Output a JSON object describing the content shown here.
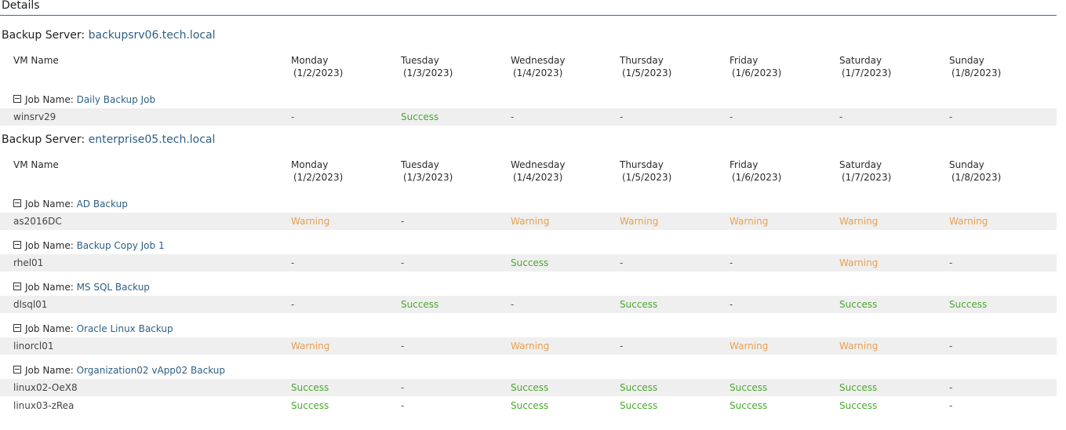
{
  "section_title": "Details",
  "server_label": "Backup Server: ",
  "job_label": "Job Name: ",
  "vm_name_header": "VM Name",
  "days": [
    {
      "day": "Monday",
      "date": "(1/2/2023)"
    },
    {
      "day": "Tuesday",
      "date": "(1/3/2023)"
    },
    {
      "day": "Wednesday",
      "date": "(1/4/2023)"
    },
    {
      "day": "Thursday",
      "date": "(1/5/2023)"
    },
    {
      "day": "Friday",
      "date": "(1/6/2023)"
    },
    {
      "day": "Saturday",
      "date": "(1/7/2023)"
    },
    {
      "day": "Sunday",
      "date": "(1/8/2023)"
    }
  ],
  "colors": {
    "success": "#4aa82f",
    "warning": "#e8a050",
    "link": "#2d5f85",
    "rule": "#3e6a85"
  },
  "servers": [
    {
      "name": "backupsrv06.tech.local",
      "jobs": [
        {
          "name": "Daily Backup Job",
          "vms": [
            {
              "name": "winsrv29",
              "statuses": [
                "-",
                "Success",
                "-",
                "-",
                "-",
                "-",
                "-"
              ]
            }
          ]
        }
      ]
    },
    {
      "name": "enterprise05.tech.local",
      "jobs": [
        {
          "name": "AD Backup",
          "vms": [
            {
              "name": "as2016DC",
              "statuses": [
                "Warning",
                "-",
                "Warning",
                "Warning",
                "Warning",
                "Warning",
                "Warning"
              ]
            }
          ]
        },
        {
          "name": "Backup Copy Job 1",
          "vms": [
            {
              "name": "rhel01",
              "statuses": [
                "-",
                "-",
                "Success",
                "-",
                "-",
                "Warning",
                "-"
              ]
            }
          ]
        },
        {
          "name": "MS SQL Backup",
          "vms": [
            {
              "name": "dlsql01",
              "statuses": [
                "-",
                "Success",
                "-",
                "Success",
                "-",
                "Success",
                "Success"
              ]
            }
          ]
        },
        {
          "name": "Oracle Linux Backup",
          "vms": [
            {
              "name": "linorcl01",
              "statuses": [
                "Warning",
                "-",
                "Warning",
                "-",
                "Warning",
                "Warning",
                "-"
              ]
            }
          ]
        },
        {
          "name": "Organization02 vApp02 Backup",
          "vms": [
            {
              "name": "linux02-OeX8",
              "statuses": [
                "Success",
                "-",
                "Success",
                "Success",
                "Success",
                "Success",
                "-"
              ]
            },
            {
              "name": "linux03-zRea",
              "statuses": [
                "Success",
                "-",
                "Success",
                "Success",
                "Success",
                "Success",
                "-"
              ]
            }
          ]
        }
      ]
    }
  ]
}
